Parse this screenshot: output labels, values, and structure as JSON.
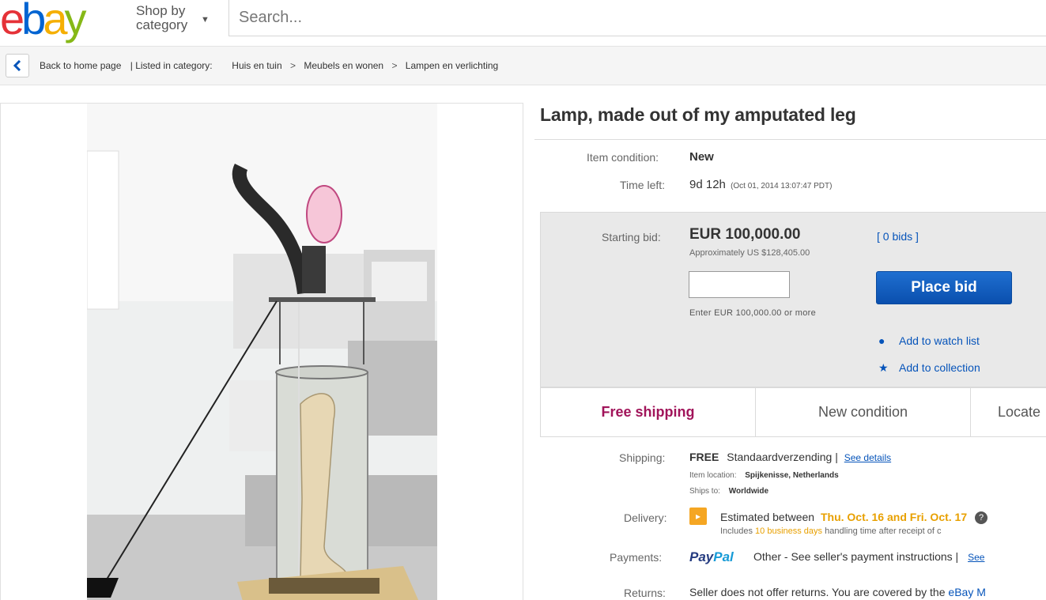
{
  "header": {
    "logo_letters": [
      {
        "ch": "e",
        "color": "#e53238"
      },
      {
        "ch": "b",
        "color": "#0064d2"
      },
      {
        "ch": "a",
        "color": "#f5af02"
      },
      {
        "ch": "y",
        "color": "#86b817"
      }
    ],
    "shop_by_line1": "Shop by",
    "shop_by_line2": "category",
    "search_placeholder": "Search..."
  },
  "breadcrumb": {
    "back_label": "Back to home page",
    "listed_in": "| Listed in category:",
    "items": [
      "Huis en tuin",
      "Meubels en wonen",
      "Lampen en verlichting"
    ]
  },
  "item": {
    "title": "Lamp, made out of my amputated leg",
    "condition_label": "Item condition:",
    "condition_value": "New",
    "time_left_label": "Time left:",
    "time_left_value": "9d 12h",
    "time_left_detail": "(Oct 01, 2014   13:07:47 PDT)"
  },
  "bid": {
    "starting_label": "Starting bid:",
    "amount": "EUR 100,000.00",
    "approx": "Approximately US $128,405.00",
    "bids_link": "[ 0 bids ]",
    "input_value": "",
    "hint": "Enter EUR 100,000.00 or more",
    "place_bid": "Place bid",
    "watch_list": "Add to watch list",
    "collection": "Add to collection"
  },
  "features": {
    "free_shipping": "Free shipping",
    "new_condition": "New condition",
    "located": "Locate"
  },
  "shipping": {
    "label": "Shipping:",
    "free": "FREE",
    "method": "Standaardverzending |",
    "see_details": "See details",
    "item_location_label": "Item location:",
    "item_location_value": "Spijkenisse, Netherlands",
    "ships_to_label": "Ships to:",
    "ships_to_value": "Worldwide"
  },
  "delivery": {
    "label": "Delivery:",
    "estimated": "Estimated between",
    "dates": "Thu. Oct. 16 and Fri. Oct. 17",
    "includes": "Includes",
    "business_days": "10 business days",
    "handling": "handling time after receipt of c"
  },
  "payments": {
    "label": "Payments:",
    "paypal_pay": "Pay",
    "paypal_pal": "Pal",
    "other": "Other - See seller's payment instructions  |",
    "see": "See"
  },
  "returns": {
    "label": "Returns:",
    "text": "Seller does not offer returns. You are covered by the",
    "link": "eBay M"
  }
}
